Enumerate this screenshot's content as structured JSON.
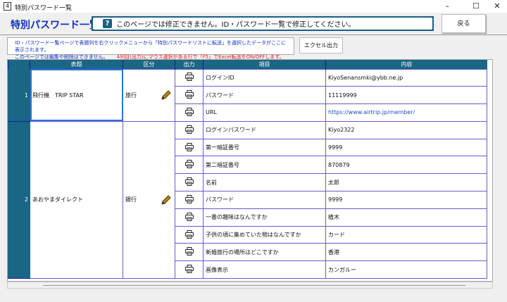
{
  "window": {
    "title": "特別パスワード一覧",
    "minimize": "–",
    "maximize": "☐",
    "close": "✕"
  },
  "header": {
    "title": "特別パスワード一覧",
    "notice": "このページでは修正できません。ID・パスワード一覧で修正してください。",
    "notice_icon": "?",
    "back_label": "戻る"
  },
  "info": {
    "line1": "ID・パスワード一覧ページで表題列を右クリックメニューから「特別パスワードリストに転送」を選択したデータがここに表示されます。",
    "line2": "このページでは編集や削除はできません。",
    "line2_red": "4列目(出力)にマウス選択がある行で「F5」でExcel転送をON/OFFします。",
    "excel_label": "エクセル出力"
  },
  "table": {
    "headers": [
      "",
      "表題",
      "区分",
      "出力",
      "項目",
      "内容"
    ],
    "groups": [
      {
        "num": "1",
        "title": "飛行機　TRIP STAR",
        "kubun": "旅行",
        "items": [
          {
            "label": "ログインID",
            "value": "KiyoSenansmki@ybb.ne.jp"
          },
          {
            "label": "パスワード",
            "value": "11119999"
          },
          {
            "label": "URL",
            "value": "https://www.airtrip.jp/member/",
            "link": true
          }
        ]
      },
      {
        "num": "2",
        "title": "あおやまダイレクト",
        "kubun": "銀行",
        "items": [
          {
            "label": "ログインパスワード",
            "value": "Kiyo2322"
          },
          {
            "label": "第一暗証番号",
            "value": "9999"
          },
          {
            "label": "第二暗証番号",
            "value": "870879"
          },
          {
            "label": "名前",
            "value": "太郎"
          },
          {
            "label": "パスワード",
            "value": "9999"
          },
          {
            "label": "一番の趣味はなんですか",
            "value": "植木"
          },
          {
            "label": "子供の頃に集めていた物はなんですか",
            "value": "カード"
          },
          {
            "label": "新婚旅行の場所はどこですか",
            "value": "香港"
          },
          {
            "label": "画像表示",
            "value": "カンガルー"
          }
        ]
      }
    ]
  }
}
